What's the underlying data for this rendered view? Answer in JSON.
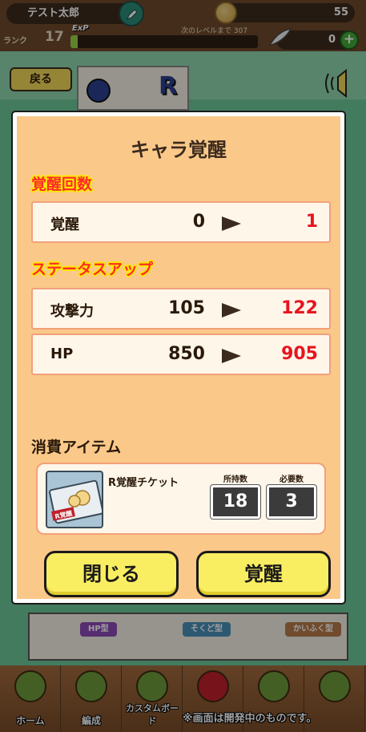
{
  "header": {
    "player_name": "テスト太郎",
    "coins": "55",
    "rank_label": "ランク",
    "rank_value": "17",
    "exp_tag": "ExP",
    "exp_progress_percent": 4,
    "next_level_label": "次のレベルまで",
    "next_level_value": "307",
    "feathers": "0",
    "plus_label": "+"
  },
  "scene": {
    "back_label": "戻る",
    "rarity": "R",
    "tags": [
      "HP型",
      "そくど型",
      "かいふく型"
    ]
  },
  "modal": {
    "title": "キャラ覚醒",
    "awaken_section": "覚醒回数",
    "awaken_row": {
      "label": "覚醒",
      "from": "0",
      "to": "1"
    },
    "status_section": "ステータスアップ",
    "stats": [
      {
        "label": "攻撃力",
        "from": "105",
        "to": "122"
      },
      {
        "label": "HP",
        "from": "850",
        "to": "905"
      }
    ],
    "items_section": "消費アイテム",
    "item": {
      "name": "R覚醒チケット",
      "ticket_text": "R覚醒",
      "owned_label": "所持数",
      "owned": "18",
      "required_label": "必要数",
      "required": "3"
    },
    "close_button": "閉じる",
    "awaken_button": "覚醒"
  },
  "bottom_nav": [
    {
      "label": "ホーム"
    },
    {
      "label": "編成"
    },
    {
      "label": "カスタムボード"
    },
    {
      "label": ""
    },
    {
      "label": ""
    },
    {
      "label": ""
    }
  ],
  "disclaimer": "※画面は開発中のものです。",
  "colors": {
    "modal_bg": "#fac889",
    "accent_red": "#e8141e",
    "button_yellow": "#f9ee62",
    "section_head_red": "#ff2a2a",
    "section_head_glow": "#ffe900"
  }
}
